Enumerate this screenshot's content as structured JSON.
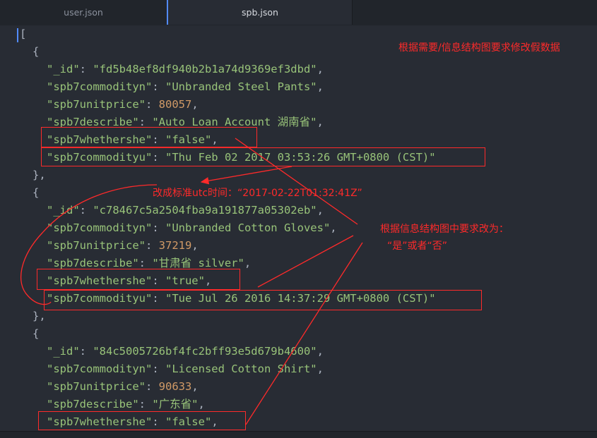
{
  "tabs": [
    {
      "label": "user.json"
    },
    {
      "label": "spb.json"
    }
  ],
  "code": {
    "open_bracket": "[",
    "records": [
      {
        "_id": "\"fd5b48ef8df940b2b1a74d9369ef3dbd\"",
        "spb7commodityn": "\"Unbranded Steel Pants\"",
        "spb7unitprice": "80057",
        "spb7describe": "\"Auto Loan Account 湖南省\"",
        "spb7whethershe": "\"false\"",
        "spb7commodityu": "\"Thu Feb 02 2017 03:53:26 GMT+0800 (CST)\""
      },
      {
        "_id": "\"c78467c5a2504fba9a191877a05302eb\"",
        "spb7commodityn": "\"Unbranded Cotton Gloves\"",
        "spb7unitprice": "37219",
        "spb7describe": "\"甘肃省 silver\"",
        "spb7whethershe": "\"true\"",
        "spb7commodityu": "\"Tue Jul 26 2016 14:37:29 GMT+0800 (CST)\""
      },
      {
        "_id": "\"84c5005726bf4fc2bff93e5d679b4600\"",
        "spb7commodityn": "\"Licensed Cotton Shirt\"",
        "spb7unitprice": "90633",
        "spb7describe": "\"广东省\"",
        "spb7whethershe": "\"false\""
      }
    ],
    "keys": {
      "_id": "\"_id\"",
      "spb7commodityn": "\"spb7commodityn\"",
      "spb7unitprice": "\"spb7unitprice\"",
      "spb7describe": "\"spb7describe\"",
      "spb7whethershe": "\"spb7whethershe\"",
      "spb7commodityu": "\"spb7commodityu\""
    },
    "open_brace": "{",
    "close_brace": "},"
  },
  "annotations": {
    "top_right": "根据需要/信息结构图要求修改假数据",
    "utc_note": "改成标准utc时间：“2017-02-22T01:32:41Z”",
    "bool_note_line1": "根据信息结构图中要求改为：",
    "bool_note_line2": "“是”或者“否”"
  },
  "colors": {
    "background": "#282c34",
    "key": "#98c379",
    "number": "#d19a66",
    "annotation": "#ff2a2a",
    "active_tab_indicator": "#528bff"
  }
}
